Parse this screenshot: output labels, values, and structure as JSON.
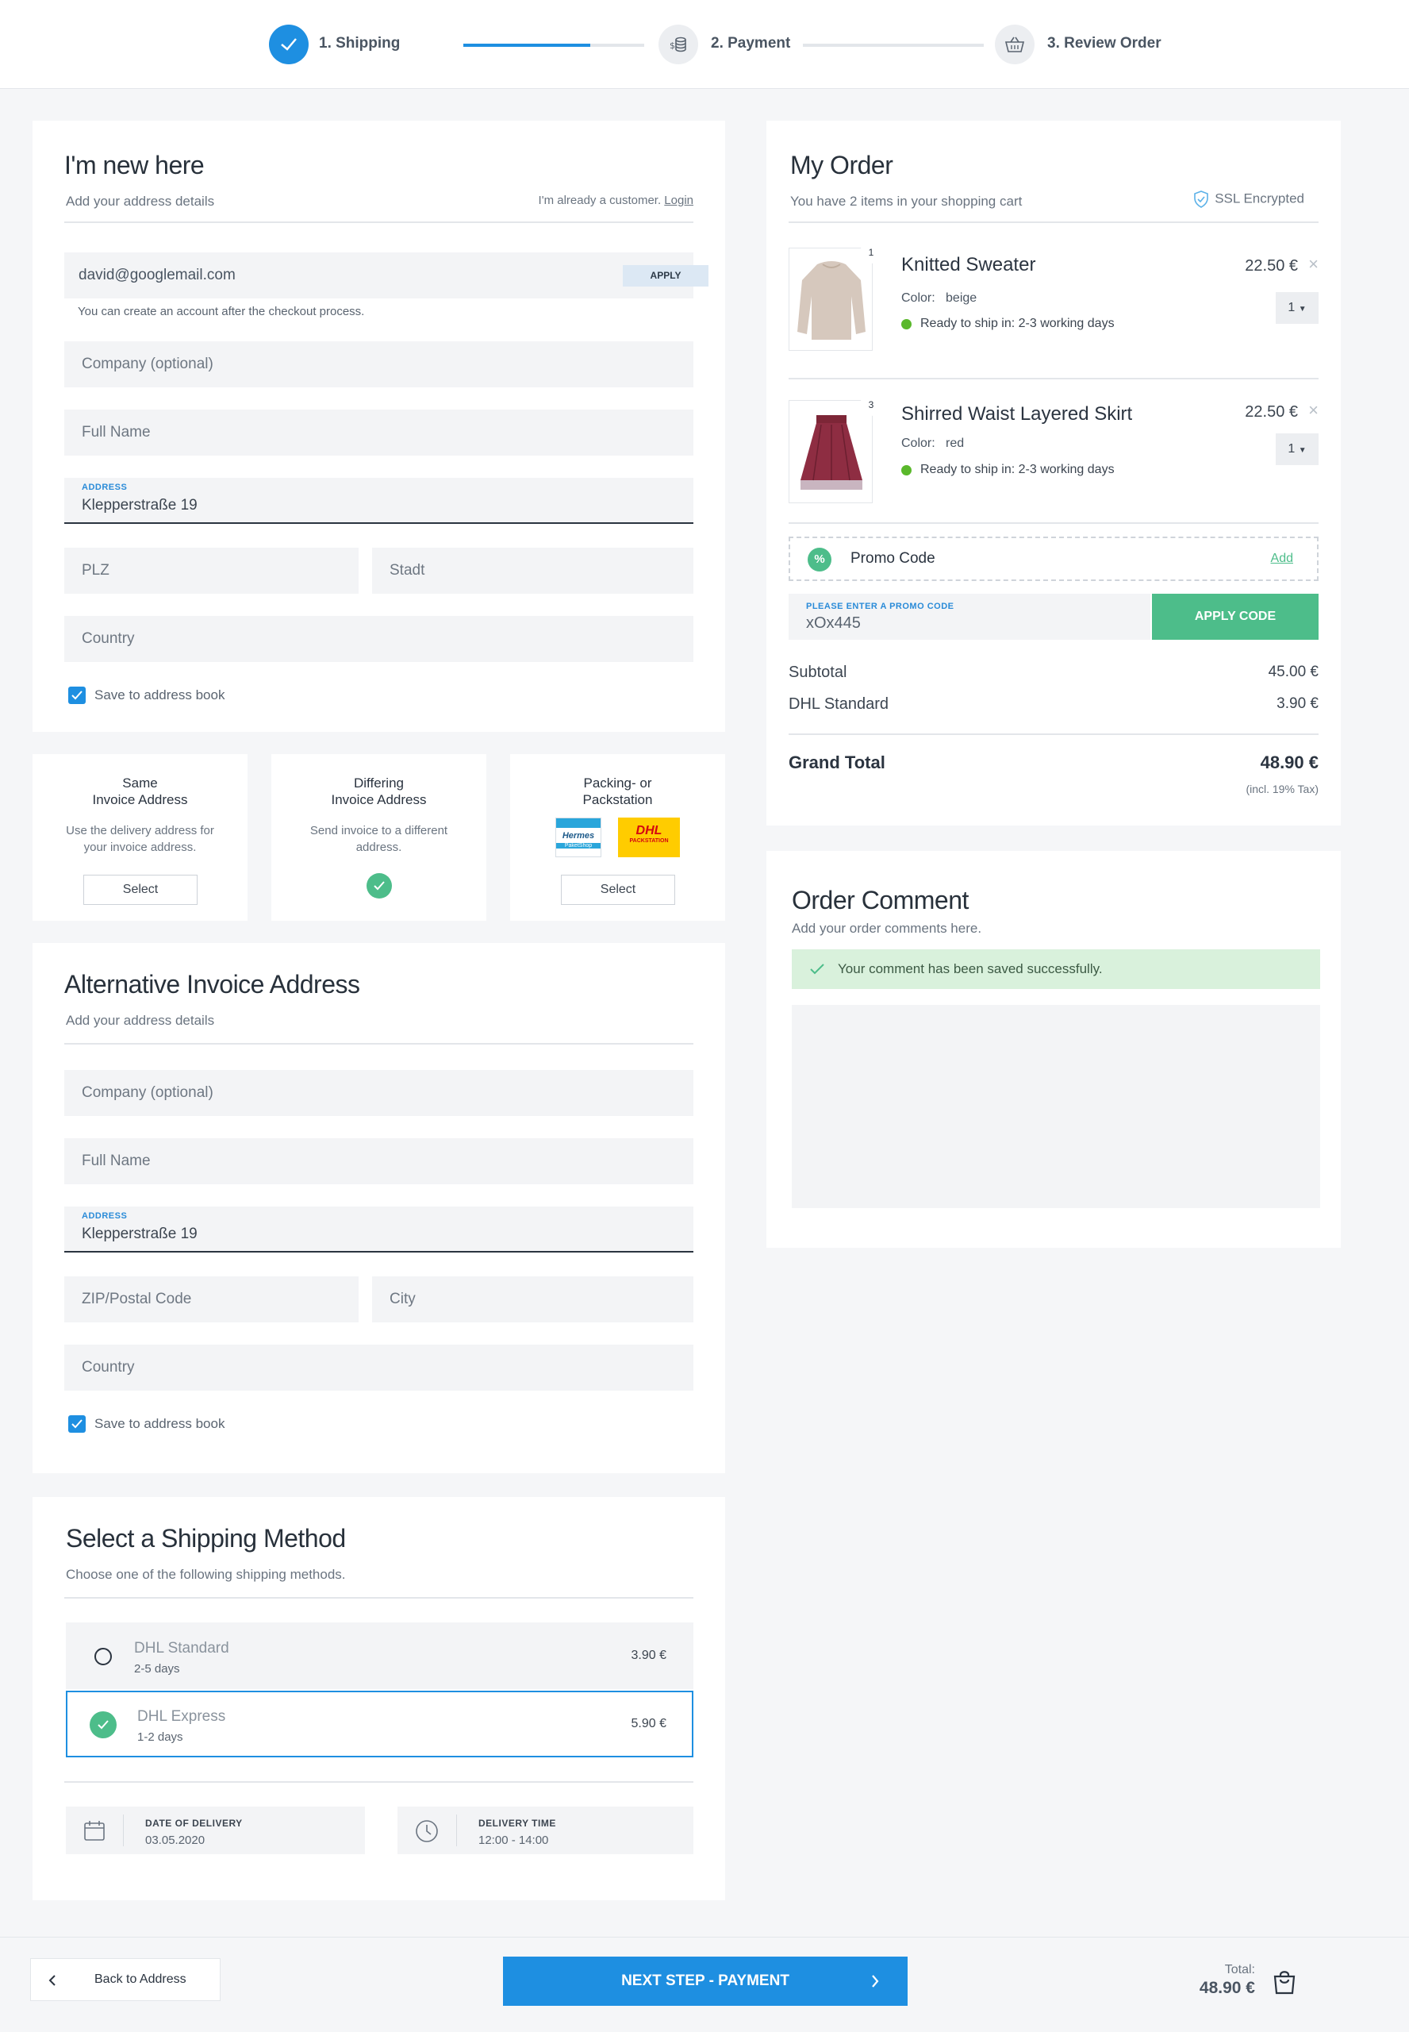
{
  "stepper": {
    "steps": [
      {
        "label": "1. Shipping"
      },
      {
        "label": "2. Payment"
      },
      {
        "label": "3. Review Order"
      }
    ]
  },
  "new_here": {
    "title": "I'm new here",
    "subtitle": "Add your address details",
    "already_customer": "I'm already a customer.",
    "login": "Login",
    "email_value": "david@googlemail.com",
    "apply": "APPLY",
    "account_hint": "You can create an account after the checkout process.",
    "company_ph": "Company (optional)",
    "fullname_ph": "Full Name",
    "address_label": "ADDRESS",
    "address_value": "Klepperstraße 19",
    "plz_ph": "PLZ",
    "stadt_ph": "Stadt",
    "country_ph": "Country",
    "save_label": "Save to address book"
  },
  "invoice_options": [
    {
      "title1": "Same",
      "title2": "Invoice Address",
      "desc1": "Use the delivery address for",
      "desc2": "your invoice address.",
      "button": "Select"
    },
    {
      "title1": "Differing",
      "title2": "Invoice Address",
      "desc1": "Send invoice to a different",
      "desc2": "address."
    },
    {
      "title1": "Packing- or",
      "title2": "Packstation",
      "hermes": "Hermes",
      "hermes_sub": "PaketShop",
      "dhl": "DHL",
      "dhl_sub": "PACKSTATION",
      "button": "Select"
    }
  ],
  "alt_invoice": {
    "title": "Alternative Invoice Address",
    "subtitle": "Add your address details",
    "company_ph": "Company (optional)",
    "fullname_ph": "Full Name",
    "address_label": "ADDRESS",
    "address_value": "Klepperstraße 19",
    "zip_ph": "ZIP/Postal Code",
    "city_ph": "City",
    "country_ph": "Country",
    "save_label": "Save to address book"
  },
  "shipping": {
    "title": "Select a Shipping Method",
    "subtitle": "Choose one of the following shipping methods.",
    "methods": [
      {
        "name": "DHL Standard",
        "days": "2-5 days",
        "price": "3.90 €"
      },
      {
        "name": "DHL Express",
        "days": "1-2 days",
        "price": "5.90 €"
      }
    ],
    "date_label": "DATE OF DELIVERY",
    "date_value": "03.05.2020",
    "time_label": "DELIVERY TIME",
    "time_value": "12:00 - 14:00"
  },
  "order": {
    "title": "My Order",
    "subtitle": "You have 2 items in your shopping cart",
    "ssl": "SSL Encrypted",
    "items": [
      {
        "badge": "1",
        "name": "Knitted Sweater",
        "color_label": "Color:",
        "color": "beige",
        "ship": "Ready to ship in: 2-3 working days",
        "price": "22.50 €",
        "qty": "1"
      },
      {
        "badge": "3",
        "name": "Shirred Waist Layered Skirt",
        "color_label": "Color:",
        "color": "red",
        "ship": "Ready to ship in: 2-3 working days",
        "price": "22.50 €",
        "qty": "1"
      }
    ],
    "promo_label": "Promo Code",
    "promo_add": "Add",
    "promo_input_label": "PLEASE ENTER A PROMO CODE",
    "promo_value": "xOx445",
    "apply_code": "APPLY CODE",
    "subtotal_label": "Subtotal",
    "subtotal": "45.00 €",
    "shipping_label": "DHL Standard",
    "shipping_cost": "3.90 €",
    "grand_label": "Grand Total",
    "grand": "48.90 €",
    "tax": "(incl. 19% Tax)"
  },
  "comment": {
    "title": "Order Comment",
    "subtitle": "Add your order comments here.",
    "success": "Your comment has been saved successfully."
  },
  "footer": {
    "back": "Back to Address",
    "next": "NEXT STEP - PAYMENT",
    "total_label": "Total:",
    "total": "48.90 €"
  },
  "colors": {
    "accent": "#1e8fe1",
    "green": "#4dbd8a",
    "success_bg": "#d9f1dc"
  }
}
